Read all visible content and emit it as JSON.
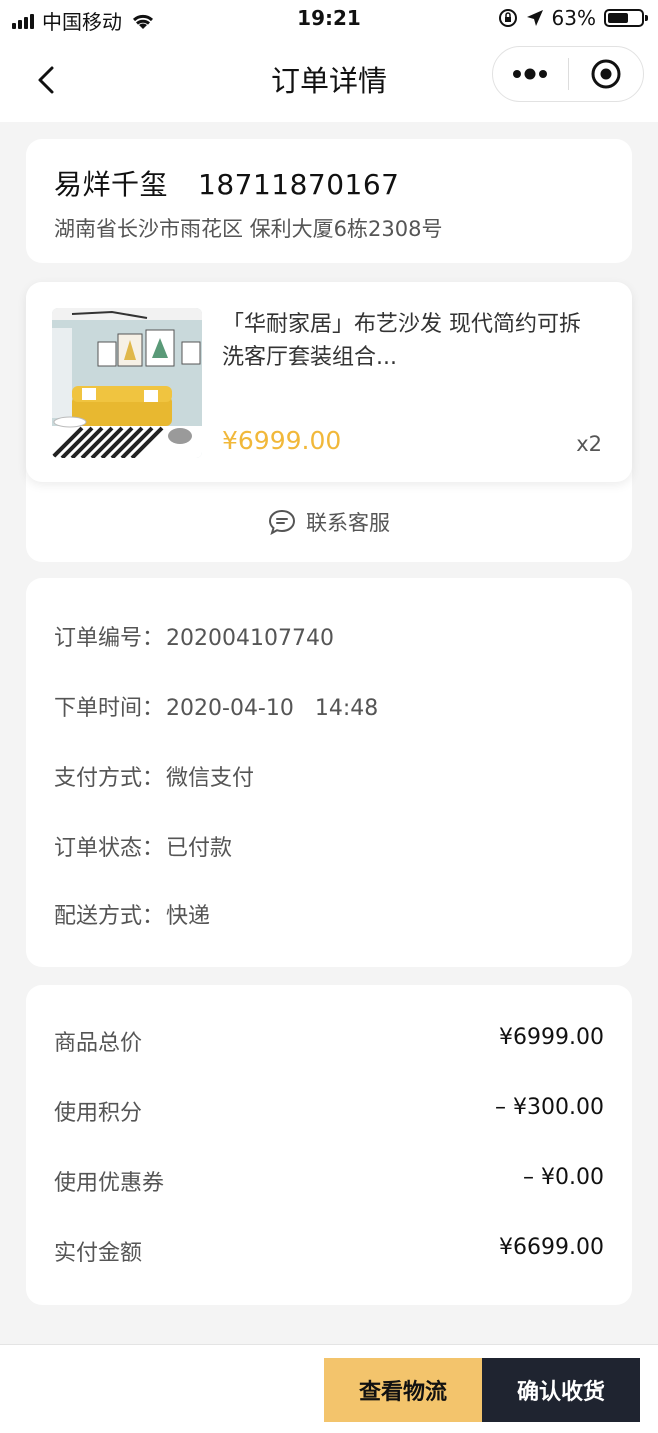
{
  "status_bar": {
    "carrier": "中国移动",
    "time": "19:21",
    "battery": "63%",
    "battery_level": 0.63,
    "icons": [
      "signal-icon",
      "wifi-icon",
      "rotation-lock-icon",
      "location-arrow-icon",
      "battery-icon"
    ]
  },
  "nav": {
    "title": "订单详情",
    "icons": [
      "back-arrow-icon",
      "more-dots-icon",
      "close-target-icon"
    ]
  },
  "address": {
    "name": "易烊千玺",
    "phone": "18711870167",
    "detail": "湖南省长沙市雨花区 保利大厦6栋2308号"
  },
  "product": {
    "title": "「华耐家居」布艺沙发 现代简约可拆洗客厅套装组合...",
    "price": "¥6999.00",
    "quantity": "x2",
    "image": "yellow-sofa-photo"
  },
  "service": {
    "label": "联系客服",
    "icon": "chat-bubble-icon"
  },
  "order_info": {
    "rows": [
      {
        "label": "订单编号：",
        "value": "202004107740"
      },
      {
        "label": "下单时间：",
        "value": "2020-04-10   14:48"
      },
      {
        "label": "支付方式：",
        "value": "微信支付"
      },
      {
        "label": "订单状态：",
        "value": "已付款"
      },
      {
        "label": "配送方式：",
        "value": "快递"
      }
    ]
  },
  "totals": {
    "rows": [
      {
        "label": "商品总价",
        "value": "¥6999.00"
      },
      {
        "label": "使用积分",
        "value": "– ¥300.00"
      },
      {
        "label": "使用优惠券",
        "value": "– ¥0.00"
      },
      {
        "label": "实付金额",
        "value": "¥6699.00"
      }
    ]
  },
  "actions": {
    "logistics": "查看物流",
    "confirm": "确认收货"
  },
  "colors": {
    "price": "#f1b83a",
    "logistics_button": "#f3c46c",
    "confirm_button": "#1f2430",
    "background": "#f4f4f4"
  }
}
